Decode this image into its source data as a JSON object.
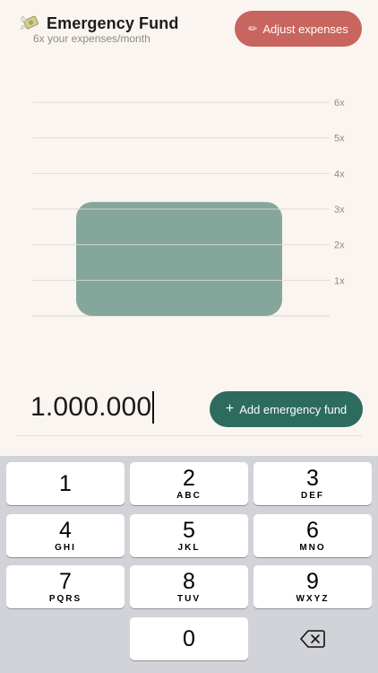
{
  "header": {
    "title": "Emergency Fund",
    "subtitle": "6x your expenses/month",
    "adjust_label": "Adjust expenses"
  },
  "chart_data": {
    "type": "bar",
    "categories": [
      ""
    ],
    "values": [
      3.2
    ],
    "y_ticks": [
      "1x",
      "2x",
      "3x",
      "4x",
      "5x",
      "6x"
    ],
    "ylim": [
      0,
      6
    ],
    "grid": true,
    "bar_color": "#85a69b"
  },
  "amount": {
    "value": "1.000.000"
  },
  "actions": {
    "add_label": "Add emergency fund"
  },
  "keypad": {
    "keys": [
      {
        "digit": "1",
        "letters": ""
      },
      {
        "digit": "2",
        "letters": "ABC"
      },
      {
        "digit": "3",
        "letters": "DEF"
      },
      {
        "digit": "4",
        "letters": "GHI"
      },
      {
        "digit": "5",
        "letters": "JKL"
      },
      {
        "digit": "6",
        "letters": "MNO"
      },
      {
        "digit": "7",
        "letters": "PQRS"
      },
      {
        "digit": "8",
        "letters": "TUV"
      },
      {
        "digit": "9",
        "letters": "WXYZ"
      },
      {
        "digit": "0",
        "letters": ""
      }
    ],
    "backspace_icon": "backspace-icon"
  },
  "colors": {
    "background": "#faf5f0",
    "adjust_button": "#c8655f",
    "add_button": "#2e6b5f",
    "bar": "#85a69b"
  }
}
